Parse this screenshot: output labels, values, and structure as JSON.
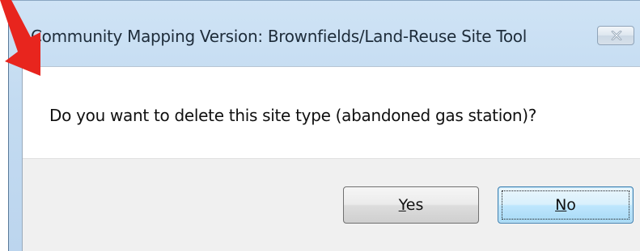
{
  "dialog": {
    "title": "Community Mapping Version: Brownfields/Land-Reuse Site Tool",
    "message": "Do you want to delete this site type (abandoned gas station)?",
    "buttons": {
      "yes": {
        "accel": "Y",
        "rest": "es"
      },
      "no": {
        "accel": "N",
        "rest": "o"
      }
    }
  },
  "colors": {
    "annotation_arrow": "#e8251e"
  },
  "icons": {
    "close": "close-icon",
    "annotation": "red-arrow-annotation"
  }
}
